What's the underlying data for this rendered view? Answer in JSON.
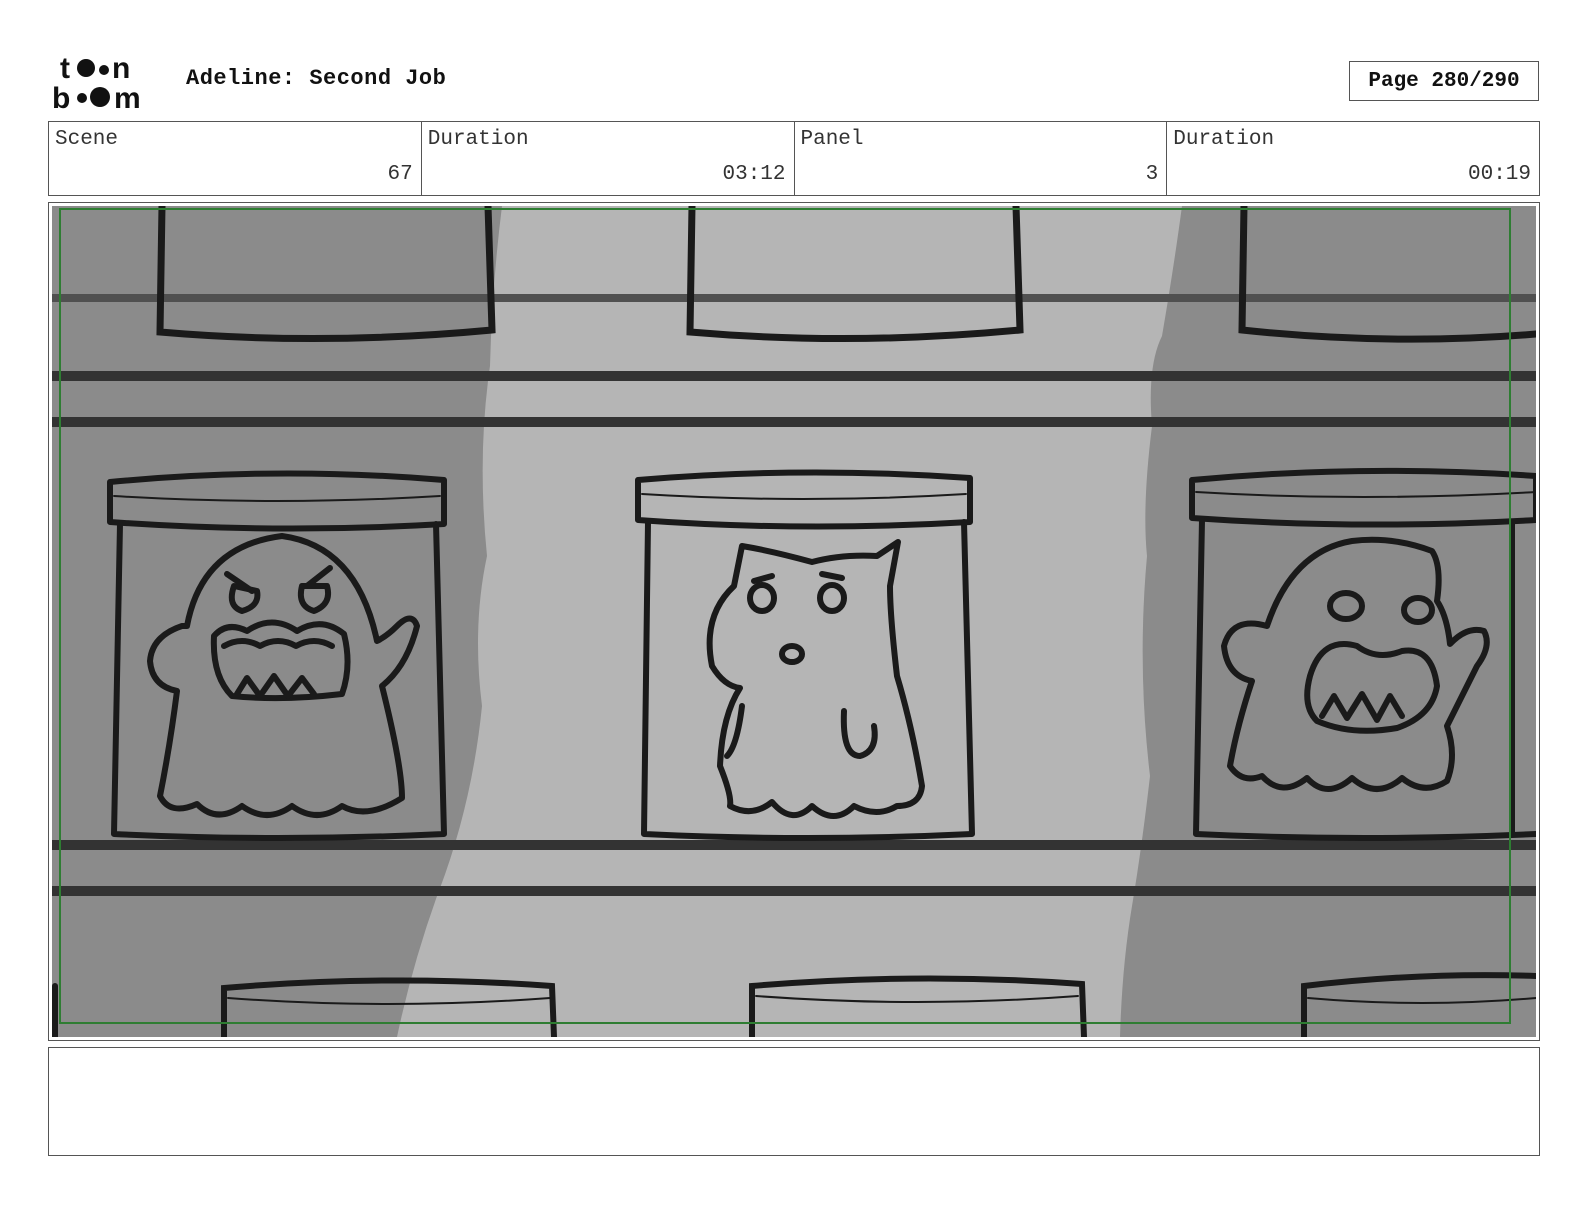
{
  "header": {
    "logo_text": "toon boom",
    "project_title": "Adeline: Second Job",
    "page_label": "Page 280/290"
  },
  "info": {
    "scene_label": "Scene",
    "scene_value": "67",
    "scene_duration_label": "Duration",
    "scene_duration_value": "03:12",
    "panel_label": "Panel",
    "panel_value": "3",
    "panel_duration_label": "Duration",
    "panel_duration_value": "00:19"
  },
  "panel": {
    "description": "Shelves of jars holding ghost and cat figures",
    "safe_frame_color": "#2e7d32"
  },
  "notes": {
    "text": ""
  }
}
